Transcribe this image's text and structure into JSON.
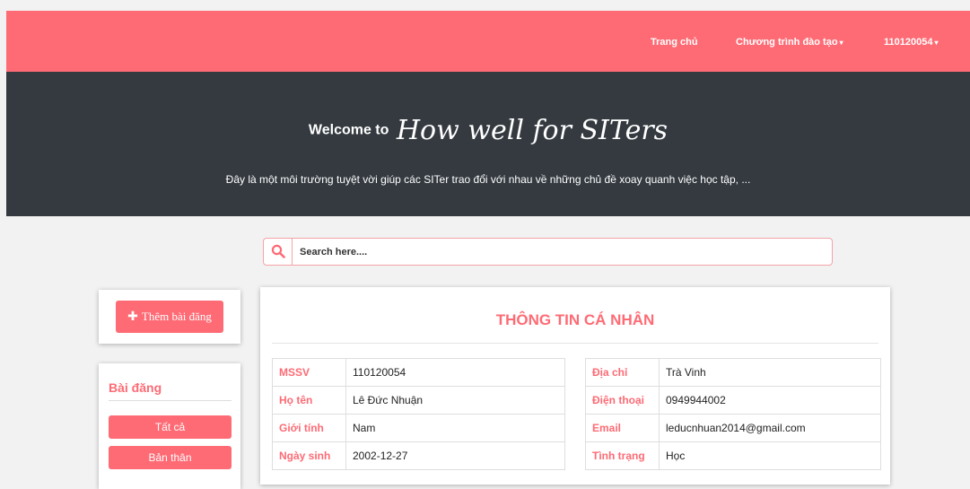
{
  "nav": {
    "home": "Trang chủ",
    "program": "Chương trình đào tạo",
    "user": "110120054"
  },
  "hero": {
    "welcome": "Welcome to",
    "brand": "How well for SITers",
    "description": "Đây là một môi trường tuyệt vời giúp các SITer trao đổi với nhau về những chủ đề xoay quanh việc học tập, ..."
  },
  "search": {
    "placeholder": "Search here...."
  },
  "sidebar": {
    "add_post": "Thêm bài đăng",
    "posts_title": "Bài đăng",
    "all": "Tất cả",
    "mine": "Bản thân"
  },
  "profile": {
    "title": "THÔNG TIN CÁ NHÂN",
    "left": [
      {
        "label": "MSSV",
        "value": "110120054"
      },
      {
        "label": "Họ tên",
        "value": "Lê Đức Nhuận"
      },
      {
        "label": "Giới tính",
        "value": "Nam"
      },
      {
        "label": "Ngày sinh",
        "value": "2002-12-27"
      }
    ],
    "right": [
      {
        "label": "Địa chỉ",
        "value": "Trà Vinh"
      },
      {
        "label": "Điện thoại",
        "value": "0949944002"
      },
      {
        "label": "Email",
        "value": "leducnhuan2014@gmail.com"
      },
      {
        "label": "Tình trạng",
        "value": "Học"
      }
    ]
  },
  "colors": {
    "accent": "#fe6b75",
    "hero_bg": "#343a40",
    "page_bg": "#f2f2f2"
  }
}
